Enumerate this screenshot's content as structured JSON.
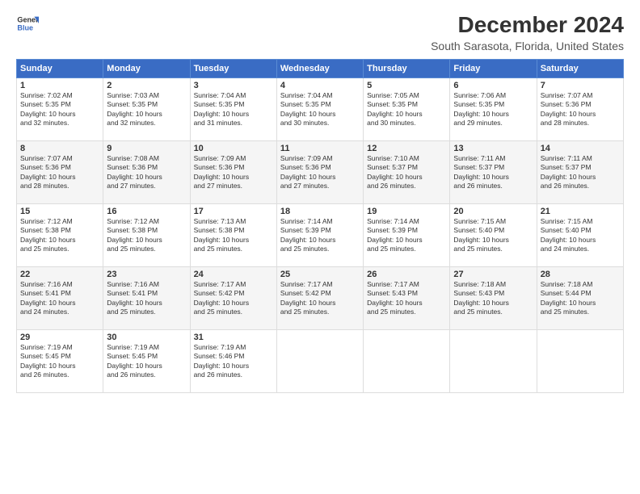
{
  "header": {
    "logo": {
      "line1": "General",
      "line2": "Blue"
    },
    "title": "December 2024",
    "subtitle": "South Sarasota, Florida, United States"
  },
  "calendar": {
    "headers": [
      "Sunday",
      "Monday",
      "Tuesday",
      "Wednesday",
      "Thursday",
      "Friday",
      "Saturday"
    ],
    "weeks": [
      [
        {
          "day": "1",
          "info": "Sunrise: 7:02 AM\nSunset: 5:35 PM\nDaylight: 10 hours\nand 32 minutes."
        },
        {
          "day": "2",
          "info": "Sunrise: 7:03 AM\nSunset: 5:35 PM\nDaylight: 10 hours\nand 32 minutes."
        },
        {
          "day": "3",
          "info": "Sunrise: 7:04 AM\nSunset: 5:35 PM\nDaylight: 10 hours\nand 31 minutes."
        },
        {
          "day": "4",
          "info": "Sunrise: 7:04 AM\nSunset: 5:35 PM\nDaylight: 10 hours\nand 30 minutes."
        },
        {
          "day": "5",
          "info": "Sunrise: 7:05 AM\nSunset: 5:35 PM\nDaylight: 10 hours\nand 30 minutes."
        },
        {
          "day": "6",
          "info": "Sunrise: 7:06 AM\nSunset: 5:35 PM\nDaylight: 10 hours\nand 29 minutes."
        },
        {
          "day": "7",
          "info": "Sunrise: 7:07 AM\nSunset: 5:36 PM\nDaylight: 10 hours\nand 28 minutes."
        }
      ],
      [
        {
          "day": "8",
          "info": "Sunrise: 7:07 AM\nSunset: 5:36 PM\nDaylight: 10 hours\nand 28 minutes."
        },
        {
          "day": "9",
          "info": "Sunrise: 7:08 AM\nSunset: 5:36 PM\nDaylight: 10 hours\nand 27 minutes."
        },
        {
          "day": "10",
          "info": "Sunrise: 7:09 AM\nSunset: 5:36 PM\nDaylight: 10 hours\nand 27 minutes."
        },
        {
          "day": "11",
          "info": "Sunrise: 7:09 AM\nSunset: 5:36 PM\nDaylight: 10 hours\nand 27 minutes."
        },
        {
          "day": "12",
          "info": "Sunrise: 7:10 AM\nSunset: 5:37 PM\nDaylight: 10 hours\nand 26 minutes."
        },
        {
          "day": "13",
          "info": "Sunrise: 7:11 AM\nSunset: 5:37 PM\nDaylight: 10 hours\nand 26 minutes."
        },
        {
          "day": "14",
          "info": "Sunrise: 7:11 AM\nSunset: 5:37 PM\nDaylight: 10 hours\nand 26 minutes."
        }
      ],
      [
        {
          "day": "15",
          "info": "Sunrise: 7:12 AM\nSunset: 5:38 PM\nDaylight: 10 hours\nand 25 minutes."
        },
        {
          "day": "16",
          "info": "Sunrise: 7:12 AM\nSunset: 5:38 PM\nDaylight: 10 hours\nand 25 minutes."
        },
        {
          "day": "17",
          "info": "Sunrise: 7:13 AM\nSunset: 5:38 PM\nDaylight: 10 hours\nand 25 minutes."
        },
        {
          "day": "18",
          "info": "Sunrise: 7:14 AM\nSunset: 5:39 PM\nDaylight: 10 hours\nand 25 minutes."
        },
        {
          "day": "19",
          "info": "Sunrise: 7:14 AM\nSunset: 5:39 PM\nDaylight: 10 hours\nand 25 minutes."
        },
        {
          "day": "20",
          "info": "Sunrise: 7:15 AM\nSunset: 5:40 PM\nDaylight: 10 hours\nand 25 minutes."
        },
        {
          "day": "21",
          "info": "Sunrise: 7:15 AM\nSunset: 5:40 PM\nDaylight: 10 hours\nand 24 minutes."
        }
      ],
      [
        {
          "day": "22",
          "info": "Sunrise: 7:16 AM\nSunset: 5:41 PM\nDaylight: 10 hours\nand 24 minutes."
        },
        {
          "day": "23",
          "info": "Sunrise: 7:16 AM\nSunset: 5:41 PM\nDaylight: 10 hours\nand 25 minutes."
        },
        {
          "day": "24",
          "info": "Sunrise: 7:17 AM\nSunset: 5:42 PM\nDaylight: 10 hours\nand 25 minutes."
        },
        {
          "day": "25",
          "info": "Sunrise: 7:17 AM\nSunset: 5:42 PM\nDaylight: 10 hours\nand 25 minutes."
        },
        {
          "day": "26",
          "info": "Sunrise: 7:17 AM\nSunset: 5:43 PM\nDaylight: 10 hours\nand 25 minutes."
        },
        {
          "day": "27",
          "info": "Sunrise: 7:18 AM\nSunset: 5:43 PM\nDaylight: 10 hours\nand 25 minutes."
        },
        {
          "day": "28",
          "info": "Sunrise: 7:18 AM\nSunset: 5:44 PM\nDaylight: 10 hours\nand 25 minutes."
        }
      ],
      [
        {
          "day": "29",
          "info": "Sunrise: 7:19 AM\nSunset: 5:45 PM\nDaylight: 10 hours\nand 26 minutes."
        },
        {
          "day": "30",
          "info": "Sunrise: 7:19 AM\nSunset: 5:45 PM\nDaylight: 10 hours\nand 26 minutes."
        },
        {
          "day": "31",
          "info": "Sunrise: 7:19 AM\nSunset: 5:46 PM\nDaylight: 10 hours\nand 26 minutes."
        },
        null,
        null,
        null,
        null
      ]
    ]
  }
}
